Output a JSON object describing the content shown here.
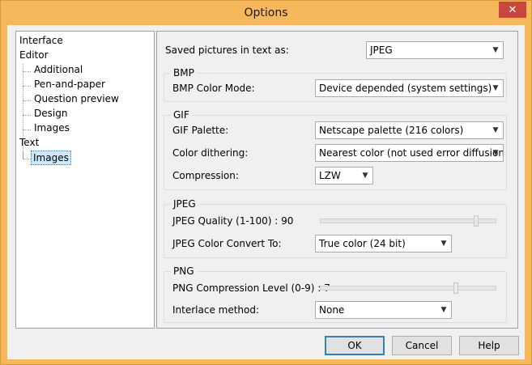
{
  "window": {
    "title": "Options",
    "close_glyph": "✕"
  },
  "tree": {
    "items": [
      "Interface",
      "Editor",
      "Additional",
      "Pen-and-paper",
      "Question preview",
      "Design",
      "Images",
      "Text",
      "Images"
    ]
  },
  "saved_pictures": {
    "label": "Saved pictures in text as:",
    "value": "JPEG"
  },
  "bmp": {
    "title": "BMP",
    "color_mode_label": "BMP Color Mode:",
    "color_mode_value": "Device depended (system settings)"
  },
  "gif": {
    "title": "GIF",
    "palette_label": "GIF Palette:",
    "palette_value": "Netscape palette (216 colors)",
    "dithering_label": "Color dithering:",
    "dithering_value": "Nearest color (not used error diffusion)",
    "compression_label": "Compression:",
    "compression_value": "LZW"
  },
  "jpeg": {
    "title": "JPEG",
    "quality_label": "JPEG Quality (1-100) : 90",
    "quality_fraction": 0.9,
    "convert_label": "JPEG Color Convert To:",
    "convert_value": "True color (24 bit)"
  },
  "png": {
    "title": "PNG",
    "compression_label": "PNG Compression Level (0-9) : 7",
    "compression_fraction": 0.78,
    "interlace_label": "Interlace method:",
    "interlace_value": "None"
  },
  "buttons": {
    "ok": "OK",
    "cancel": "Cancel",
    "help": "Help"
  },
  "colors": {
    "titlebar": "#f6b85b",
    "close": "#c7463d",
    "selection": "#cce8ff"
  }
}
